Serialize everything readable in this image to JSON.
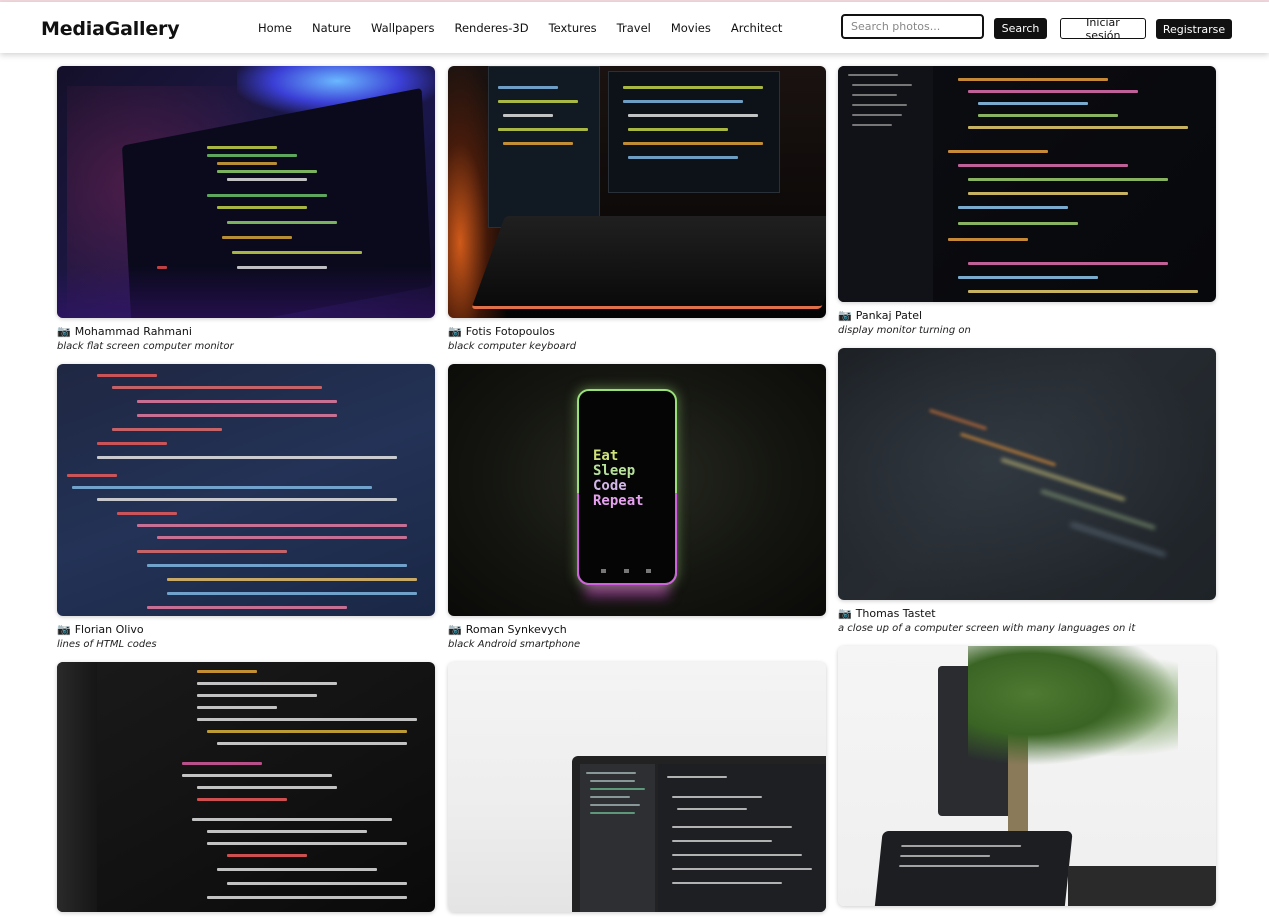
{
  "header": {
    "logo": "MediaGallery",
    "nav": [
      "Home",
      "Nature",
      "Wallpapers",
      "Renderes-3D",
      "Textures",
      "Travel",
      "Movies",
      "Architect"
    ],
    "search_placeholder": "Search photos...",
    "search_label": "Search",
    "login_label": "Iniciar sesión",
    "register_label": "Registrarse"
  },
  "camera_icon": "camera-icon",
  "photos": [
    {
      "author": "Mohammad Rahmani",
      "description": "black flat screen computer monitor"
    },
    {
      "author": "Fotis Fotopoulos",
      "description": "black computer keyboard"
    },
    {
      "author": "Pankaj Patel",
      "description": "display monitor turning on"
    },
    {
      "author": "Florian Olivo",
      "description": "lines of HTML codes"
    },
    {
      "author": "Roman Synkevych",
      "description": "black Android smartphone"
    },
    {
      "author": "Thomas Tastet",
      "description": "a close up of a computer screen with many languages on it"
    }
  ],
  "phone_text": [
    "Eat",
    "Sleep",
    "Code",
    "Repeat"
  ]
}
